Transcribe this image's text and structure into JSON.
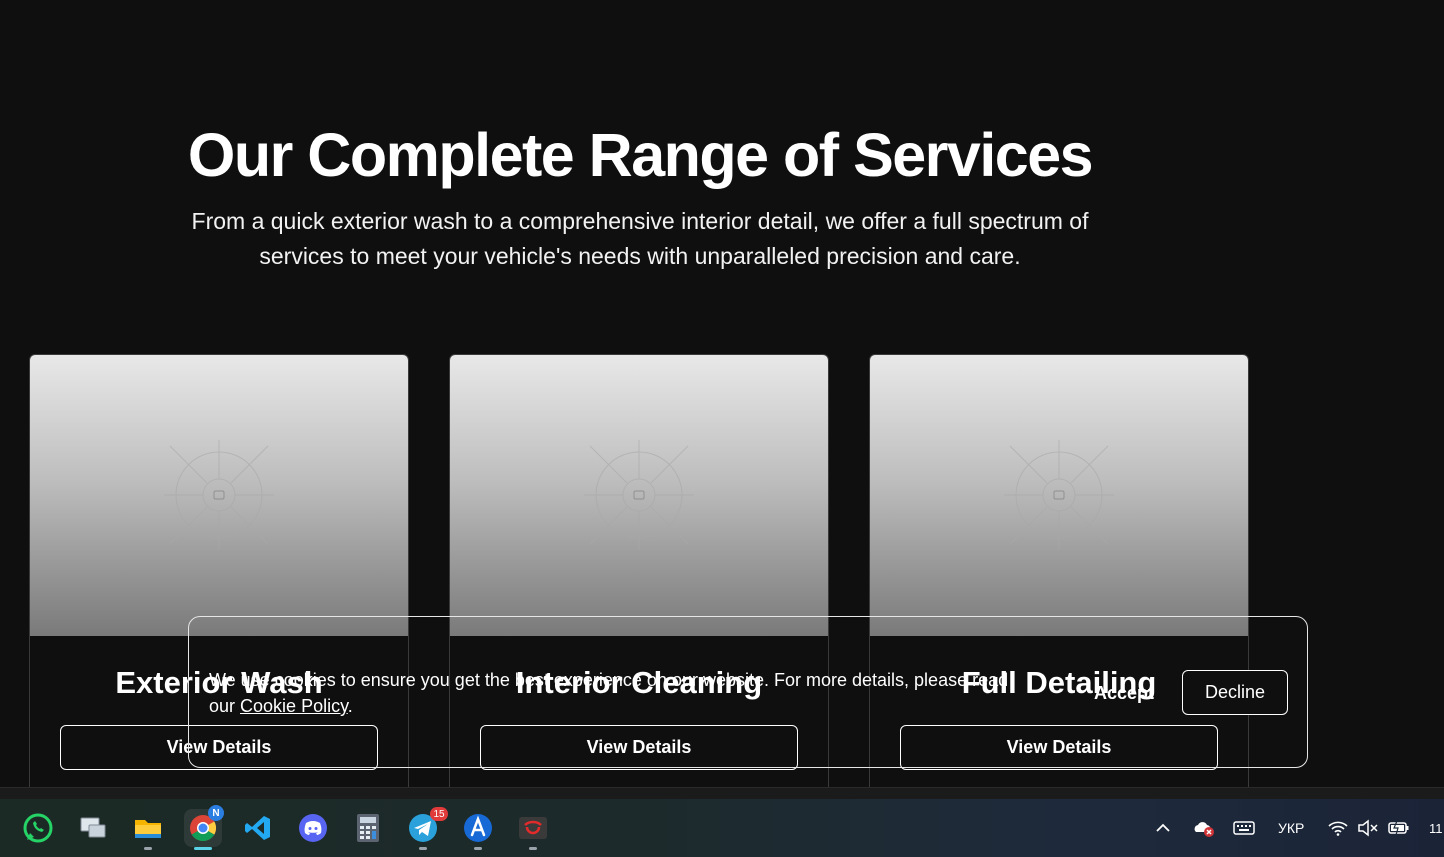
{
  "hero": {
    "title": "Our Complete Range of Services",
    "subtitle_line1": "From a quick exterior wash to a comprehensive interior detail, we offer a full spectrum of",
    "subtitle_line2": "services to meet your vehicle's needs with unparalleled precision and care."
  },
  "services": [
    {
      "title": "Exterior Wash",
      "button": "View Details"
    },
    {
      "title": "Interior Cleaning",
      "button": "View Details"
    },
    {
      "title": "Full Detailing",
      "button": "View Details"
    }
  ],
  "cookie_banner": {
    "text_line1": "We use cookies to ensure you get the best experience on our website. For more details, please read",
    "text_prefix": "our ",
    "link": "Cookie Policy",
    "text_suffix": ".",
    "accept": "Accept",
    "decline": "Decline"
  },
  "taskbar": {
    "apps": [
      {
        "name": "whatsapp-icon"
      },
      {
        "name": "remote-desktop-icon"
      },
      {
        "name": "file-explorer-icon"
      },
      {
        "name": "chrome-icon",
        "badge": "N",
        "active": true
      },
      {
        "name": "vscode-icon"
      },
      {
        "name": "discord-icon"
      },
      {
        "name": "calculator-icon"
      },
      {
        "name": "telegram-icon",
        "badge": "15"
      },
      {
        "name": "browser-icon"
      },
      {
        "name": "app-red-icon"
      }
    ],
    "language": "УКР",
    "clock_partial": "11"
  },
  "colors": {
    "background": "#0f0f0f",
    "card_border": "#3a3a3a",
    "text": "#ffffff"
  }
}
